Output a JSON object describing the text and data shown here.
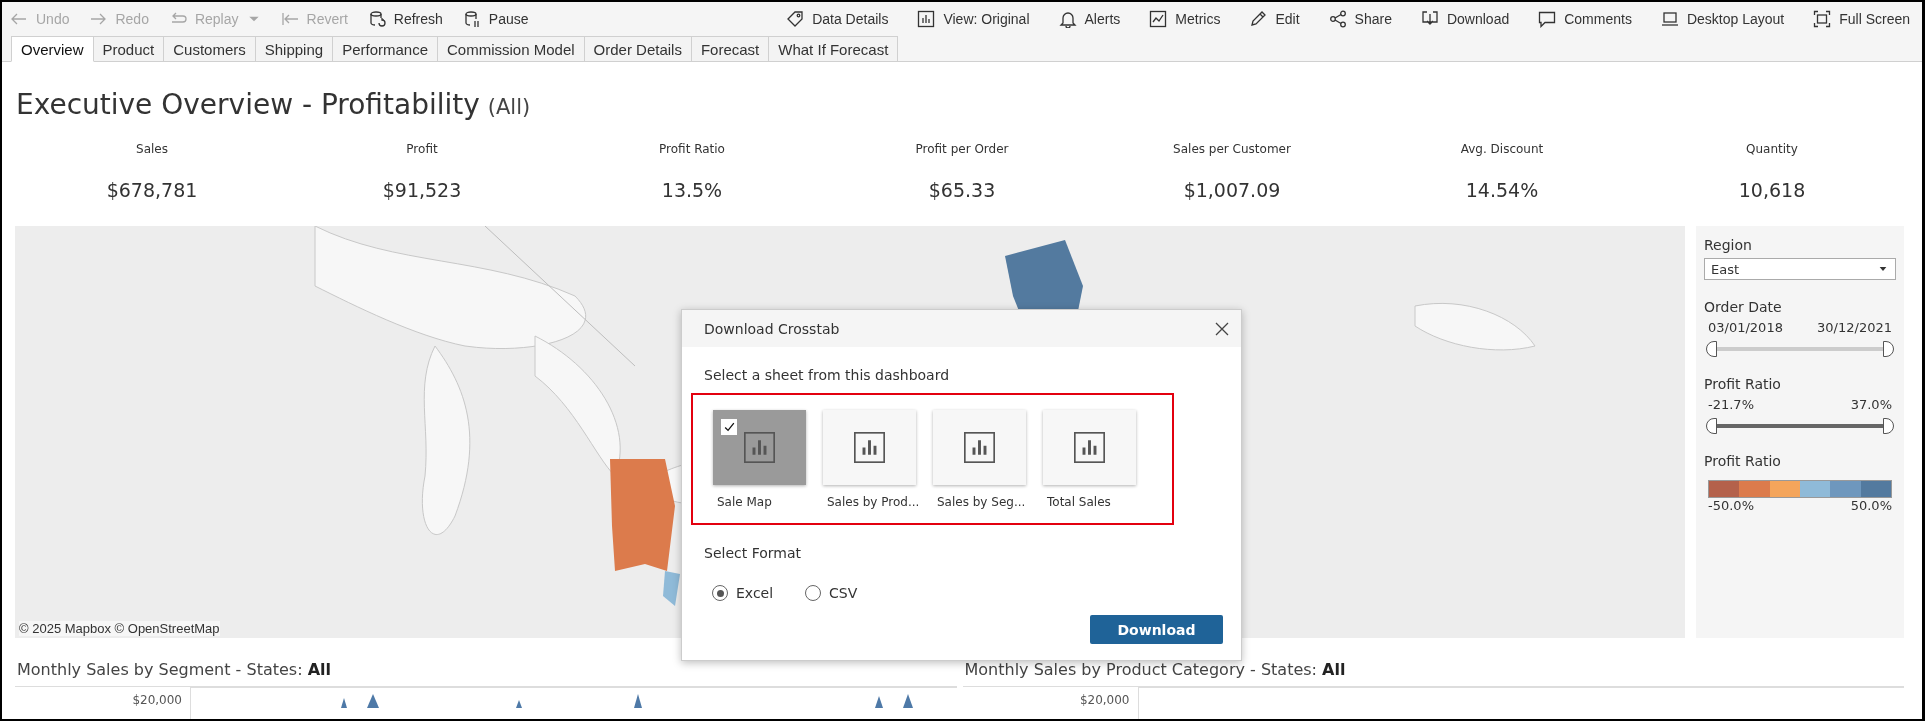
{
  "toolbar": {
    "left": [
      {
        "label": "Undo",
        "disabled": true,
        "has_menu": false
      },
      {
        "label": "Redo",
        "disabled": true,
        "has_menu": false
      },
      {
        "label": "Replay",
        "disabled": true,
        "has_menu": true
      },
      {
        "label": "Revert",
        "disabled": true,
        "has_menu": false
      },
      {
        "label": "Refresh",
        "disabled": false,
        "has_menu": false
      },
      {
        "label": "Pause",
        "disabled": false,
        "has_menu": false
      }
    ],
    "right": [
      {
        "label": "Data Details"
      },
      {
        "label": "View: Original"
      },
      {
        "label": "Alerts"
      },
      {
        "label": "Metrics"
      },
      {
        "label": "Edit"
      },
      {
        "label": "Share"
      },
      {
        "label": "Download"
      },
      {
        "label": "Comments"
      },
      {
        "label": "Desktop Layout"
      },
      {
        "label": "Full Screen"
      }
    ]
  },
  "tabs": [
    {
      "label": "Overview",
      "selected": true
    },
    {
      "label": "Product",
      "selected": false
    },
    {
      "label": "Customers",
      "selected": false
    },
    {
      "label": "Shipping",
      "selected": false
    },
    {
      "label": "Performance",
      "selected": false
    },
    {
      "label": "Commission Model",
      "selected": false
    },
    {
      "label": "Order Details",
      "selected": false
    },
    {
      "label": "Forecast",
      "selected": false
    },
    {
      "label": "What If Forecast",
      "selected": false
    }
  ],
  "title": "Executive Overview - Profitability",
  "title_filter": "(All)",
  "kpis": [
    {
      "label": "Sales",
      "value": "$678,781"
    },
    {
      "label": "Profit",
      "value": "$91,523"
    },
    {
      "label": "Profit Ratio",
      "value": "13.5%"
    },
    {
      "label": "Profit per Order",
      "value": "$65.33"
    },
    {
      "label": "Sales per Customer",
      "value": "$1,007.09"
    },
    {
      "label": "Avg. Discount",
      "value": "14.54%"
    },
    {
      "label": "Quantity",
      "value": "10,618"
    }
  ],
  "map": {
    "attribution": "© 2025 Mapbox © OpenStreetMap"
  },
  "filters": {
    "region": {
      "label": "Region",
      "value": "East"
    },
    "sliders": [
      {
        "label": "Order Date",
        "min": "03/01/2018",
        "max": "30/12/2021",
        "kind": "date",
        "level": 1
      },
      {
        "label": "Profit Ratio",
        "min": "-21.7%",
        "max": "37.0%",
        "kind": "number",
        "level": 1
      }
    ],
    "legend": {
      "label": "Profit Ratio",
      "min": "-50.0%",
      "max": "50.0%",
      "bins": [
        {
          "color": "#b4614b"
        },
        {
          "color": "#dc7b4c"
        },
        {
          "color": "#f4a55b"
        },
        {
          "color": "#8fbad8"
        },
        {
          "color": "#6e97bd"
        },
        {
          "color": "#537a9f"
        }
      ]
    }
  },
  "dialog": {
    "title": "Download Crosstab",
    "sheet_prompt": "Select a sheet from this dashboard",
    "sheets": [
      {
        "label": "Sale Map",
        "selected": true
      },
      {
        "label": "Sales by Prod...",
        "selected": false
      },
      {
        "label": "Sales by Seg...",
        "selected": false
      },
      {
        "label": "Total Sales",
        "selected": false
      }
    ],
    "format_prompt": "Select Format",
    "formats": [
      {
        "label": "Excel",
        "selected": true
      },
      {
        "label": "CSV",
        "selected": false
      }
    ],
    "button": "Download"
  },
  "bottom_charts": [
    {
      "title": "Monthly Sales by Segment - States: **All**",
      "axis_label": "$20,000",
      "kind": "area"
    },
    {
      "title": "Monthly Sales by Product Category - States: **All**",
      "axis_label": "$20,000",
      "kind": "empty"
    }
  ]
}
